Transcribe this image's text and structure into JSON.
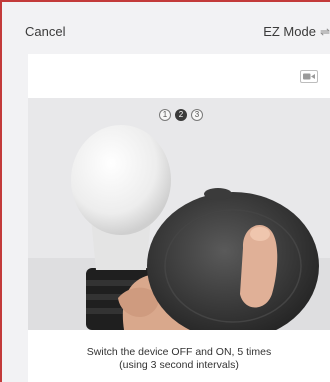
{
  "header": {
    "cancel_label": "Cancel",
    "mode_label": "EZ Mode",
    "mode_switch_glyph": "⇌"
  },
  "steps": [
    {
      "label": "1",
      "active": false
    },
    {
      "label": "2",
      "active": true
    },
    {
      "label": "3",
      "active": false
    }
  ],
  "instruction": {
    "line1": "Switch the device OFF and ON, 5 times",
    "line2": "(using 3 second intervals)"
  },
  "icons": {
    "video": "video-camera-icon"
  },
  "colors": {
    "accent_border": "#c33a3a",
    "background": "#f2f2f4",
    "active_step": "#3a3a3a"
  }
}
